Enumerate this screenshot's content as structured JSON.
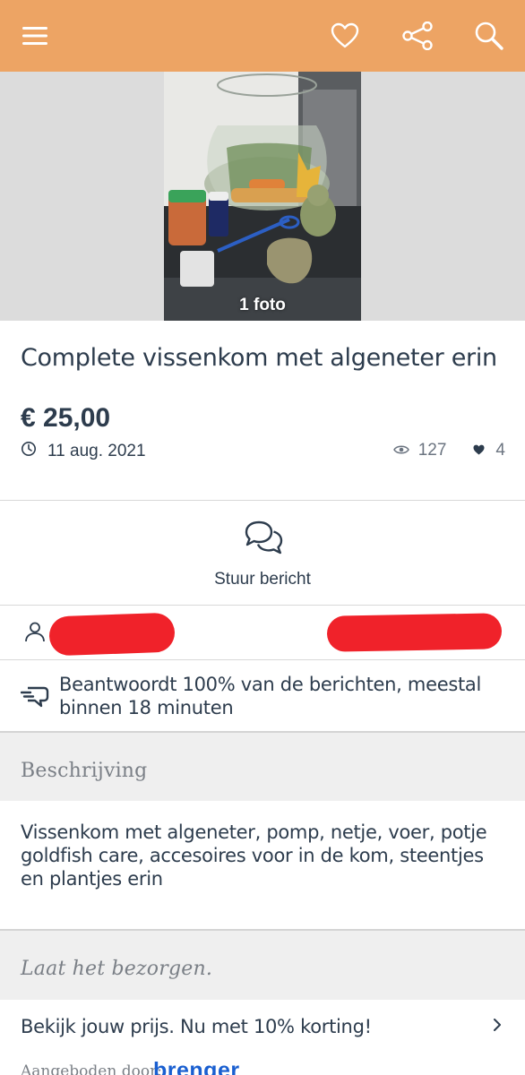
{
  "topbar": {
    "color": "#eda464",
    "icons": [
      "menu-icon",
      "heart-icon",
      "share-icon",
      "search-icon"
    ]
  },
  "listing": {
    "photo_count": "1 foto",
    "title": "Complete vissenkom met algeneter erin",
    "price": "€ 25,00",
    "date": "11 aug. 2021",
    "views": "127",
    "favorites": "4"
  },
  "actions": {
    "message_label": "Stuur bericht"
  },
  "seller": {
    "reply_text": "Beantwoordt 100% van de berichten, meestal binnen 18 minuten"
  },
  "description": {
    "heading": "Beschrijving",
    "text": "Vissenkom met algeneter, pomp, netje, voer, potje goldfish care, accesoires voor in de kom, steentjes en plantjes erin"
  },
  "delivery": {
    "heading": "Laat het bezorgen.",
    "cta": "Bekijk jouw prijs. Nu met 10% korting!",
    "offered_by": "Aangeboden door:",
    "partner": "brenger"
  }
}
